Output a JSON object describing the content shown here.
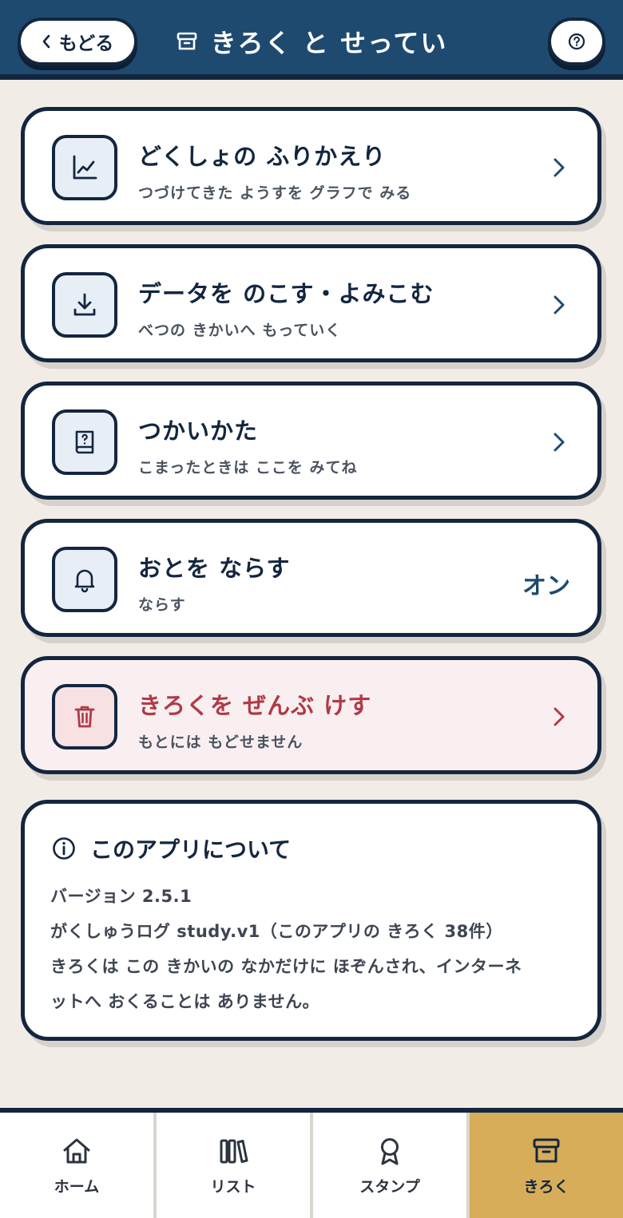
{
  "header": {
    "back_label": "もどる",
    "title": "きろく と せってい"
  },
  "menu": [
    {
      "title": "どくしょの ふりかえり",
      "subtitle": "つづけてきた ようすを グラフで みる",
      "icon": "chart-icon"
    },
    {
      "title": "データを のこす・よみこむ",
      "subtitle": "べつの きかいへ もっていく",
      "icon": "download-icon"
    },
    {
      "title": "つかいかた",
      "subtitle": "こまったときは ここを みてね",
      "icon": "help-book-icon"
    },
    {
      "title": "おとを ならす",
      "subtitle": "ならす",
      "icon": "bell-icon",
      "value": "オン"
    },
    {
      "title": "きろくを ぜんぶ けす",
      "subtitle": "もとには もどせません",
      "icon": "trash-icon"
    }
  ],
  "about": {
    "title": "このアプリについて",
    "lines": [
      "バージョン 2.5.1",
      "がくしゅうログ study.v1（このアプリの きろく 38件）",
      "きろくは この きかいの なかだけに ほぞんされ、インターネ",
      "ットへ おくることは ありません。"
    ]
  },
  "nav": [
    {
      "label": "ホーム",
      "icon": "home-icon"
    },
    {
      "label": "リスト",
      "icon": "books-icon"
    },
    {
      "label": "スタンプ",
      "icon": "badge-icon"
    },
    {
      "label": "きろく",
      "icon": "archive-icon",
      "active": true
    }
  ],
  "colors": {
    "header": "#1f4a70",
    "ink": "#13263f",
    "background": "#f1ede6",
    "danger": "#b03a47",
    "active_tab": "#d8ad5a"
  }
}
